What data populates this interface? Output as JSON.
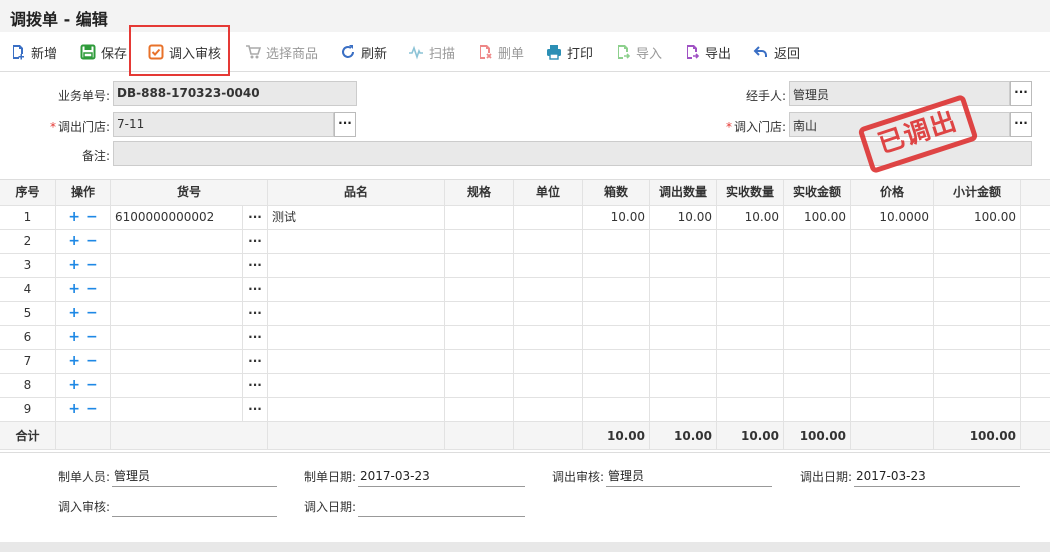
{
  "window": {
    "title": "调拨单 - 编辑"
  },
  "toolbar": {
    "items": [
      {
        "label": "新增",
        "icon": "add-doc-icon",
        "color": "#3a6fc4",
        "enabled": true
      },
      {
        "label": "保存",
        "icon": "save-icon",
        "color": "#2e9b3a",
        "enabled": true
      },
      {
        "label": "调入审核",
        "icon": "check-box-icon",
        "color": "#e8722a",
        "enabled": true
      },
      {
        "label": "选择商品",
        "icon": "cart-icon",
        "color": "#999999",
        "enabled": false
      },
      {
        "label": "刷新",
        "icon": "refresh-icon",
        "color": "#3a6fc4",
        "enabled": true
      },
      {
        "label": "扫描",
        "icon": "scan-icon",
        "color": "#999999",
        "enabled": false
      },
      {
        "label": "删单",
        "icon": "delete-doc-icon",
        "color": "#e04848",
        "enabled": false
      },
      {
        "label": "打印",
        "icon": "printer-icon",
        "color": "#2b8fb5",
        "enabled": true
      },
      {
        "label": "导入",
        "icon": "import-icon",
        "color": "#5bb55b",
        "enabled": false
      },
      {
        "label": "导出",
        "icon": "export-icon",
        "color": "#a052c4",
        "enabled": true
      },
      {
        "label": "返回",
        "icon": "back-arrow-icon",
        "color": "#3a6fc4",
        "enabled": true
      }
    ]
  },
  "form": {
    "order_no_label": "业务单号:",
    "order_no": "DB-888-170323-0040",
    "from_store_label": "调出门店:",
    "from_store": "7-11",
    "remark_label": "备注:",
    "remark": "",
    "handler_label": "经手人:",
    "handler": "管理员",
    "to_store_label": "调入门店:",
    "to_store": "南山",
    "required_mark": "*",
    "more_button": "···"
  },
  "stamp": {
    "text": "已调出",
    "color": "#d33333"
  },
  "table": {
    "headers": [
      "序号",
      "操作",
      "货号",
      "品名",
      "规格",
      "单位",
      "箱数",
      "调出数量",
      "实收数量",
      "实收金额",
      "价格",
      "小计金额"
    ],
    "rows": [
      {
        "no": "1",
        "code": "6100000000002",
        "name": "测试",
        "spec": "",
        "unit": "",
        "boxes": "10.00",
        "out_qty": "10.00",
        "recv_qty": "10.00",
        "recv_amt": "100.00",
        "price": "10.0000",
        "subtotal": "100.00"
      },
      {
        "no": "2",
        "code": "",
        "name": "",
        "spec": "",
        "unit": "",
        "boxes": "",
        "out_qty": "",
        "recv_qty": "",
        "recv_amt": "",
        "price": "",
        "subtotal": ""
      },
      {
        "no": "3",
        "code": "",
        "name": "",
        "spec": "",
        "unit": "",
        "boxes": "",
        "out_qty": "",
        "recv_qty": "",
        "recv_amt": "",
        "price": "",
        "subtotal": ""
      },
      {
        "no": "4",
        "code": "",
        "name": "",
        "spec": "",
        "unit": "",
        "boxes": "",
        "out_qty": "",
        "recv_qty": "",
        "recv_amt": "",
        "price": "",
        "subtotal": ""
      },
      {
        "no": "5",
        "code": "",
        "name": "",
        "spec": "",
        "unit": "",
        "boxes": "",
        "out_qty": "",
        "recv_qty": "",
        "recv_amt": "",
        "price": "",
        "subtotal": ""
      },
      {
        "no": "6",
        "code": "",
        "name": "",
        "spec": "",
        "unit": "",
        "boxes": "",
        "out_qty": "",
        "recv_qty": "",
        "recv_amt": "",
        "price": "",
        "subtotal": ""
      },
      {
        "no": "7",
        "code": "",
        "name": "",
        "spec": "",
        "unit": "",
        "boxes": "",
        "out_qty": "",
        "recv_qty": "",
        "recv_amt": "",
        "price": "",
        "subtotal": ""
      },
      {
        "no": "8",
        "code": "",
        "name": "",
        "spec": "",
        "unit": "",
        "boxes": "",
        "out_qty": "",
        "recv_qty": "",
        "recv_amt": "",
        "price": "",
        "subtotal": ""
      },
      {
        "no": "9",
        "code": "",
        "name": "",
        "spec": "",
        "unit": "",
        "boxes": "",
        "out_qty": "",
        "recv_qty": "",
        "recv_amt": "",
        "price": "",
        "subtotal": ""
      }
    ],
    "plus": "+",
    "minus": "−",
    "more": "···",
    "totals": {
      "label": "合计",
      "boxes": "10.00",
      "out_qty": "10.00",
      "recv_qty": "10.00",
      "recv_amt": "100.00",
      "subtotal": "100.00"
    }
  },
  "footer": {
    "creator_label": "制单人员:",
    "creator": "管理员",
    "created_date_label": "制单日期:",
    "created_date": "2017-03-23",
    "out_auditor_label": "调出审核:",
    "out_auditor": "管理员",
    "out_date_label": "调出日期:",
    "out_date": "2017-03-23",
    "in_auditor_label": "调入审核:",
    "in_auditor": "",
    "in_date_label": "调入日期:",
    "in_date": ""
  }
}
